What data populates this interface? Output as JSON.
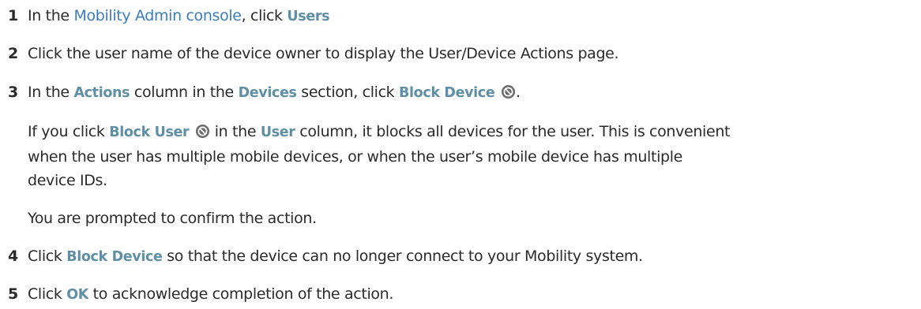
{
  "steps": [
    {
      "number": "1",
      "text": {
        "a": "In the ",
        "link": "Mobility Admin console",
        "b": ", click ",
        "ui": "Users"
      }
    },
    {
      "number": "2",
      "text": "Click the user name of the device owner to display the User/Device Actions page."
    },
    {
      "number": "3",
      "text": {
        "a": "In the ",
        "ui1": "Actions",
        "b": " column in the ",
        "ui2": "Devices",
        "c": " section, click ",
        "ui3": "Block Device",
        "d": "."
      },
      "note": {
        "a": "If you click ",
        "ui1": "Block User",
        "b": " in the ",
        "ui2": "User",
        "c": " column, it blocks all devices for the user. This is convenient",
        "line2": "when the user has multiple mobile devices, or when the user’s mobile device has multiple",
        "line3": "device IDs."
      },
      "prompt": "You are prompted to confirm the action."
    },
    {
      "number": "4",
      "text": {
        "a": "Click ",
        "ui": "Block Device",
        "b": " so that the device can no longer connect to your Mobility system."
      }
    },
    {
      "number": "5",
      "text": {
        "a": "Click ",
        "ui": "OK",
        "b": " to acknowledge completion of the action."
      }
    }
  ],
  "icons": {
    "block": "block-icon"
  },
  "colors": {
    "ui_term": "#5f8fa5",
    "link": "#3a7dbd",
    "text": "#2a2a2a"
  }
}
